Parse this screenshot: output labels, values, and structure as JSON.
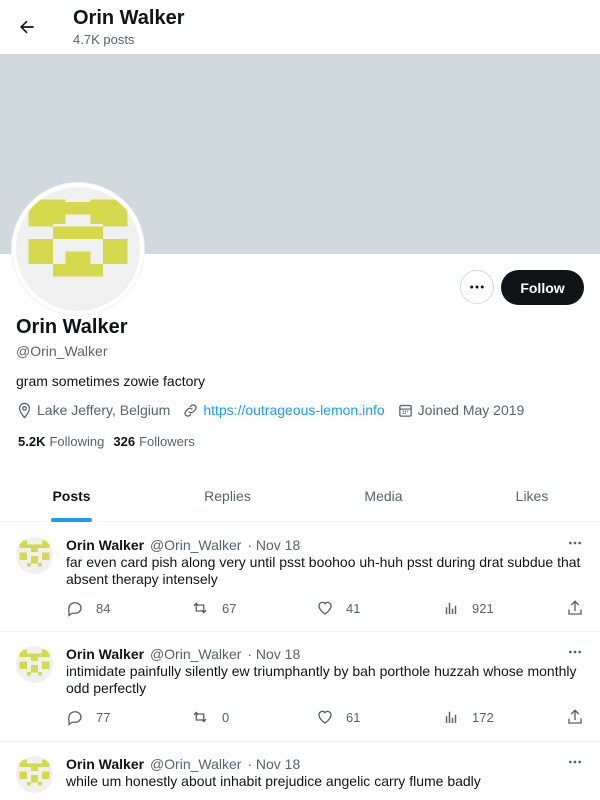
{
  "header": {
    "name": "Orin Walker",
    "post_count": "4.7K posts",
    "back_icon": "arrow-left-icon"
  },
  "colors": {
    "accent": "#1d9bf0",
    "banner": "#cfd9de",
    "avatar_pattern": "#d4d94e",
    "text_primary": "#0f1419",
    "text_secondary": "#536471"
  },
  "profile": {
    "name": "Orin Walker",
    "handle": "@Orin_Walker",
    "bio": "gram sometimes zowie factory",
    "location": "Lake Jeffery, Belgium",
    "website": "https://outrageous-lemon.info",
    "joined": "Joined May 2019",
    "following_count": "5.2K",
    "following_label": "Following",
    "followers_count": "326",
    "followers_label": "Followers",
    "follow_button": "Follow",
    "more_icon": "more-horizontal-icon"
  },
  "tabs": [
    {
      "label": "Posts",
      "active": true
    },
    {
      "label": "Replies",
      "active": false
    },
    {
      "label": "Media",
      "active": false
    },
    {
      "label": "Likes",
      "active": false
    }
  ],
  "posts": [
    {
      "name": "Orin Walker",
      "handle": "@Orin_Walker",
      "date": "· Nov 18",
      "text": "far even card pish along very until psst boohoo uh-huh psst during drat subdue that absent therapy intensely",
      "replies": "84",
      "reposts": "67",
      "likes": "41",
      "views": "921"
    },
    {
      "name": "Orin Walker",
      "handle": "@Orin_Walker",
      "date": "· Nov 18",
      "text": "intimidate painfully silently ew triumphantly by bah porthole huzzah whose monthly odd perfectly",
      "replies": "77",
      "reposts": "0",
      "likes": "61",
      "views": "172"
    },
    {
      "name": "Orin Walker",
      "handle": "@Orin_Walker",
      "date": "· Nov 18",
      "text": "while um honestly about inhabit prejudice angelic carry flume badly"
    }
  ]
}
